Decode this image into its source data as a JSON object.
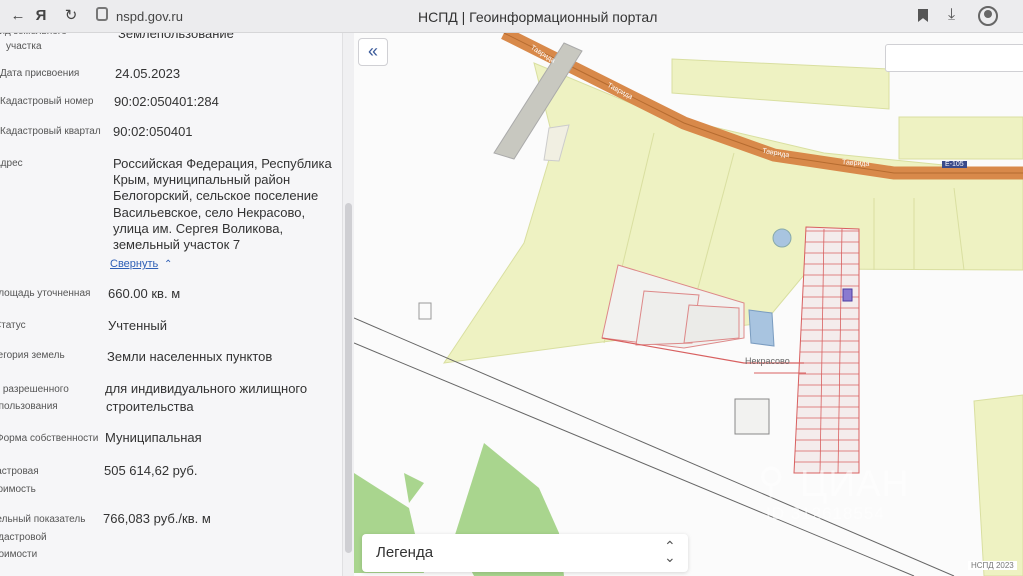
{
  "browser": {
    "url": "nspd.gov.ru",
    "title": "НСПД | Геоинформационный портал",
    "icons": [
      "back-icon",
      "yandex-icon",
      "reload-icon",
      "lock-icon",
      "bookmark-icon",
      "download-icon",
      "profile-icon"
    ]
  },
  "parcel": {
    "fields": [
      {
        "label": "вид земельного",
        "label2": "участка",
        "value": "Землепользование"
      },
      {
        "label": "Дата присвоения",
        "value": "24.05.2023"
      },
      {
        "label": "Кадастровый номер",
        "value": "90:02:050401:284"
      },
      {
        "label": "Кадастровый квартал",
        "value": "90:02:050401"
      },
      {
        "label": "Адрес"
      },
      {
        "label": "Площадь уточненная",
        "value": "660.00 кв. м"
      },
      {
        "label": "Статус",
        "value": "Учтенный"
      },
      {
        "label": "Категория земель",
        "value": "Земли населенных пунктов"
      },
      {
        "label": "Вид разрешенного",
        "label2": "использования",
        "value": "для индивидуального жилищного",
        "value2": "строительства"
      },
      {
        "label": "Форма собственности",
        "value": "Муниципальная"
      },
      {
        "label": "Кадастровая",
        "label2": "стоимость",
        "value": "505 614,62 руб."
      },
      {
        "label": "Удельный показатель",
        "label2": "кадастровой",
        "label3": "стоимости",
        "value": "766,083 руб./кв. м"
      }
    ],
    "address_lines": [
      "Российская Федерация, Республика",
      "Крым, муниципальный район",
      "Белогорский, сельское поселение",
      "Васильевское, село Некрасово,",
      "улица им. Сергея Воликова,",
      "земельный участок 7"
    ],
    "collapse_label": "Свернуть"
  },
  "map": {
    "road_labels": [
      "Таврида",
      "Таврида",
      "Таврида",
      "Таврида"
    ],
    "road_badge": "Е-105",
    "village_label": "Некрасово",
    "scale_label": "НСПД 2023",
    "legend_label": "Легенда",
    "collapse_icon": "double-chevron-left-icon",
    "watermark": {
      "brand": "ЦИАН",
      "id": "ID 312618554"
    },
    "colors": {
      "yellow_zone": "#eef2c2",
      "road": "#d8894a",
      "green": "#a9d58e",
      "parcel_border": "#d86060"
    }
  }
}
